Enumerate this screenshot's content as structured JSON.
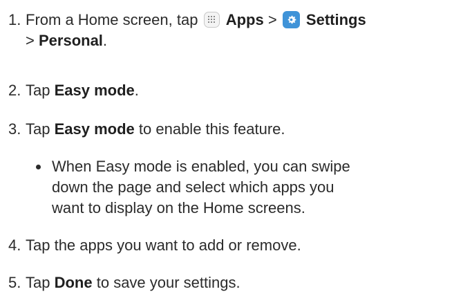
{
  "steps": [
    {
      "number": "1.",
      "pre": "From a Home screen, tap",
      "apps_label": "Apps",
      "sep1": ">",
      "settings_label": "Settings",
      "sep2": ">",
      "personal_label": "Personal",
      "end": ".",
      "apps_icon": "apps-grid-icon",
      "settings_icon": "gear-icon"
    },
    {
      "number": "2.",
      "pre": "Tap",
      "bold": "Easy mode",
      "post": "."
    },
    {
      "number": "3.",
      "pre": "Tap",
      "bold": "Easy mode",
      "post": "to enable this feature."
    },
    {
      "number": "4.",
      "text": "Tap the apps you want to add or remove."
    },
    {
      "number": "5.",
      "pre": "Tap",
      "bold": "Done",
      "post": "to save your settings."
    }
  ],
  "bullet": {
    "line1": "When Easy mode is enabled, you can swipe",
    "line2": "down the page and select which apps you",
    "line3": "want to display on the Home screens."
  },
  "colors": {
    "text": "#2b2b2b",
    "settings_icon_bg": "#3f93d8"
  }
}
